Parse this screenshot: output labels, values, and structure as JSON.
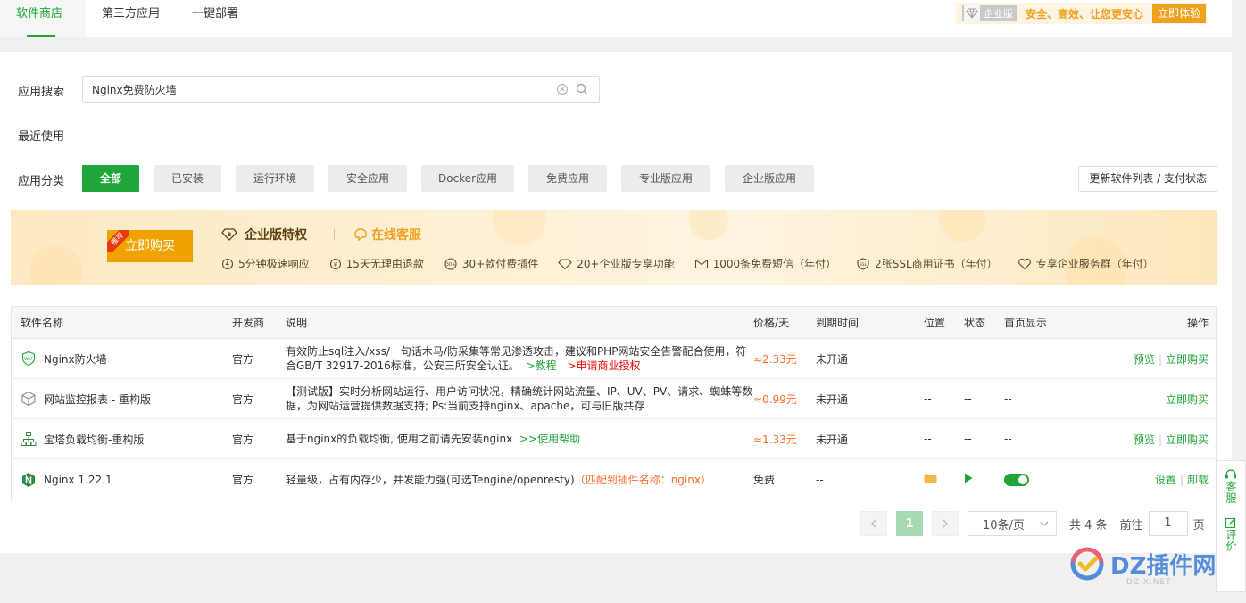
{
  "tabs": [
    {
      "label": "软件商店",
      "active": true
    },
    {
      "label": "第三方应用",
      "active": false
    },
    {
      "label": "一键部署",
      "active": false
    }
  ],
  "promo": {
    "badge": "企业版",
    "text": "安全、高效、让您更安心",
    "button": "立即体验"
  },
  "search": {
    "label": "应用搜索",
    "value": "Nginx免费防火墙"
  },
  "recent": {
    "label": "最近使用"
  },
  "categories": {
    "label": "应用分类",
    "items": [
      "全部",
      "已安装",
      "运行环境",
      "安全应用",
      "Docker应用",
      "免费应用",
      "专业版应用",
      "企业版应用"
    ],
    "active_index": 0,
    "refresh_button": "更新软件列表 / 支付状态"
  },
  "banner": {
    "buy_button": "立即购买",
    "recommend_tag": "推荐",
    "title": "企业版特权",
    "online_service": "在线客服",
    "features": [
      {
        "icon": "lightning-clock-icon",
        "text": "5分钟极速响应"
      },
      {
        "icon": "refund-icon",
        "text": "15天无理由退款"
      },
      {
        "icon": "plugin-30-icon",
        "text": "30+款付费插件"
      },
      {
        "icon": "diamond-icon",
        "text": "20+企业版专享功能"
      },
      {
        "icon": "mail-icon",
        "text": "1000条免费短信（年付）"
      },
      {
        "icon": "ssl-icon",
        "text": "2张SSL商用证书（年付）"
      },
      {
        "icon": "heart-service-icon",
        "text": "专享企业服务群（年付）"
      }
    ]
  },
  "table": {
    "headers": {
      "name": "软件名称",
      "developer": "开发商",
      "description": "说明",
      "price": "价格/天",
      "expire": "到期时间",
      "position": "位置",
      "status": "状态",
      "home": "首页显示",
      "operation": "操作"
    },
    "rows": [
      {
        "icon": "waf-shield-icon",
        "name": "Nginx防火墙",
        "developer": "官方",
        "desc_main": "有效防止sql注入/xss/一句话木马/防采集等常见渗透攻击，建议和PHP网站安全告警配合使用，符合GB/T 32917-2016标准，公安三所安全认证。",
        "desc_link1": ">教程",
        "desc_link2": ">申请商业授权",
        "price": "≈2.33元",
        "expire": "未开通",
        "position": "--",
        "status": "--",
        "home": "--",
        "op1": "预览",
        "op2": "立即购买"
      },
      {
        "icon": "cube-icon",
        "name": "网站监控报表 - 重构版",
        "developer": "官方",
        "desc_main": "【测试版】实时分析网站运行、用户访问状况，精确统计网站流量、IP、UV、PV、请求、蜘蛛等数据，为网站运营提供数据支持; Ps:当前支持nginx、apache，可与旧版共存",
        "price": "≈0.99元",
        "expire": "未开通",
        "position": "--",
        "status": "--",
        "home": "--",
        "op2": "立即购买"
      },
      {
        "icon": "network-tree-icon",
        "name": "宝塔负载均衡-重构版",
        "developer": "官方",
        "desc_main": "基于nginx的负载均衡, 使用之前请先安装nginx",
        "desc_link1": ">>使用帮助",
        "price": "≈1.33元",
        "expire": "未开通",
        "position": "--",
        "status": "--",
        "home": "--",
        "op1": "预览",
        "op2": "立即购买"
      },
      {
        "icon": "nginx-logo-icon",
        "name": "Nginx 1.22.1",
        "developer": "官方",
        "desc_main": "轻量级，占有内存少，并发能力强(可选Tengine/openresty)",
        "desc_match": "（匹配到插件名称：nginx）",
        "price": "免费",
        "expire": "--",
        "position_icon": "folder-icon",
        "status_icon": "play-icon",
        "home_toggle": true,
        "op1": "设置",
        "op2": "卸载"
      }
    ]
  },
  "pagination": {
    "current": "1",
    "page_size": "10条/页",
    "total": "共 4 条",
    "goto_label": "前往",
    "goto_value": "1",
    "page_suffix": "页"
  },
  "float_side": {
    "service": "客服",
    "review": "评价"
  },
  "watermark": {
    "text": "DZ插件网",
    "sub": "DZ-X.NET"
  },
  "colors": {
    "primary": "#20a53a",
    "accent": "#f0a11e",
    "price": "#fc6d26",
    "link_red": "#ef0808"
  }
}
